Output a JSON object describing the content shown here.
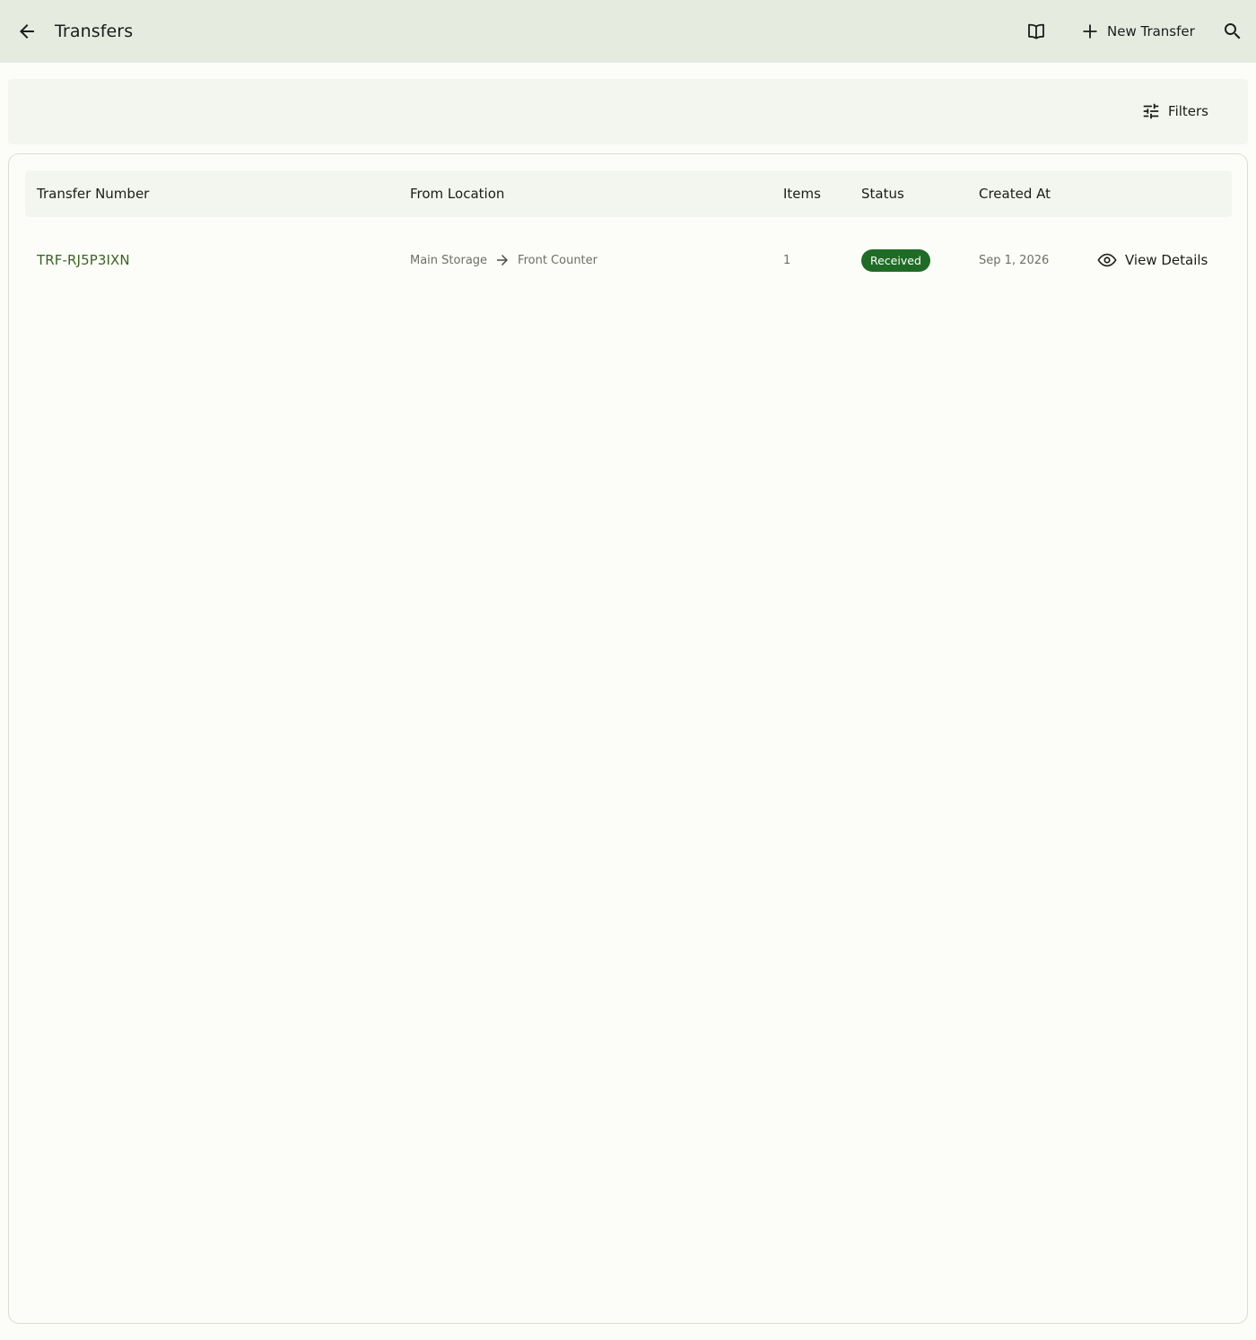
{
  "app_bar": {
    "title": "Transfers",
    "new_transfer_label": "New Transfer",
    "icons": {
      "back": "arrow-left-icon",
      "guide": "book-open-icon",
      "new": "plus-icon",
      "search": "search-icon"
    }
  },
  "filter_bar": {
    "filters_label": "Filters",
    "icon": "tune-icon"
  },
  "table": {
    "columns": [
      "Transfer Number",
      "From Location",
      "Items",
      "Status",
      "Created At"
    ],
    "rows": [
      {
        "transfer_number": "TRF-RJ5P3IXN",
        "from_location": "Main Storage",
        "to_location": "Front Counter",
        "items": "1",
        "status": "Received",
        "created_at": "Sep 1, 2026",
        "action_label": "View Details"
      }
    ]
  },
  "colors": {
    "app_bar_bg": "#e6ebdf",
    "surface": "#fcfdf9",
    "surface_variant": "#f3f6ee",
    "link_green": "#3c6321",
    "status_received_bg": "#1f6b26",
    "muted_text": "#6c6f66"
  }
}
